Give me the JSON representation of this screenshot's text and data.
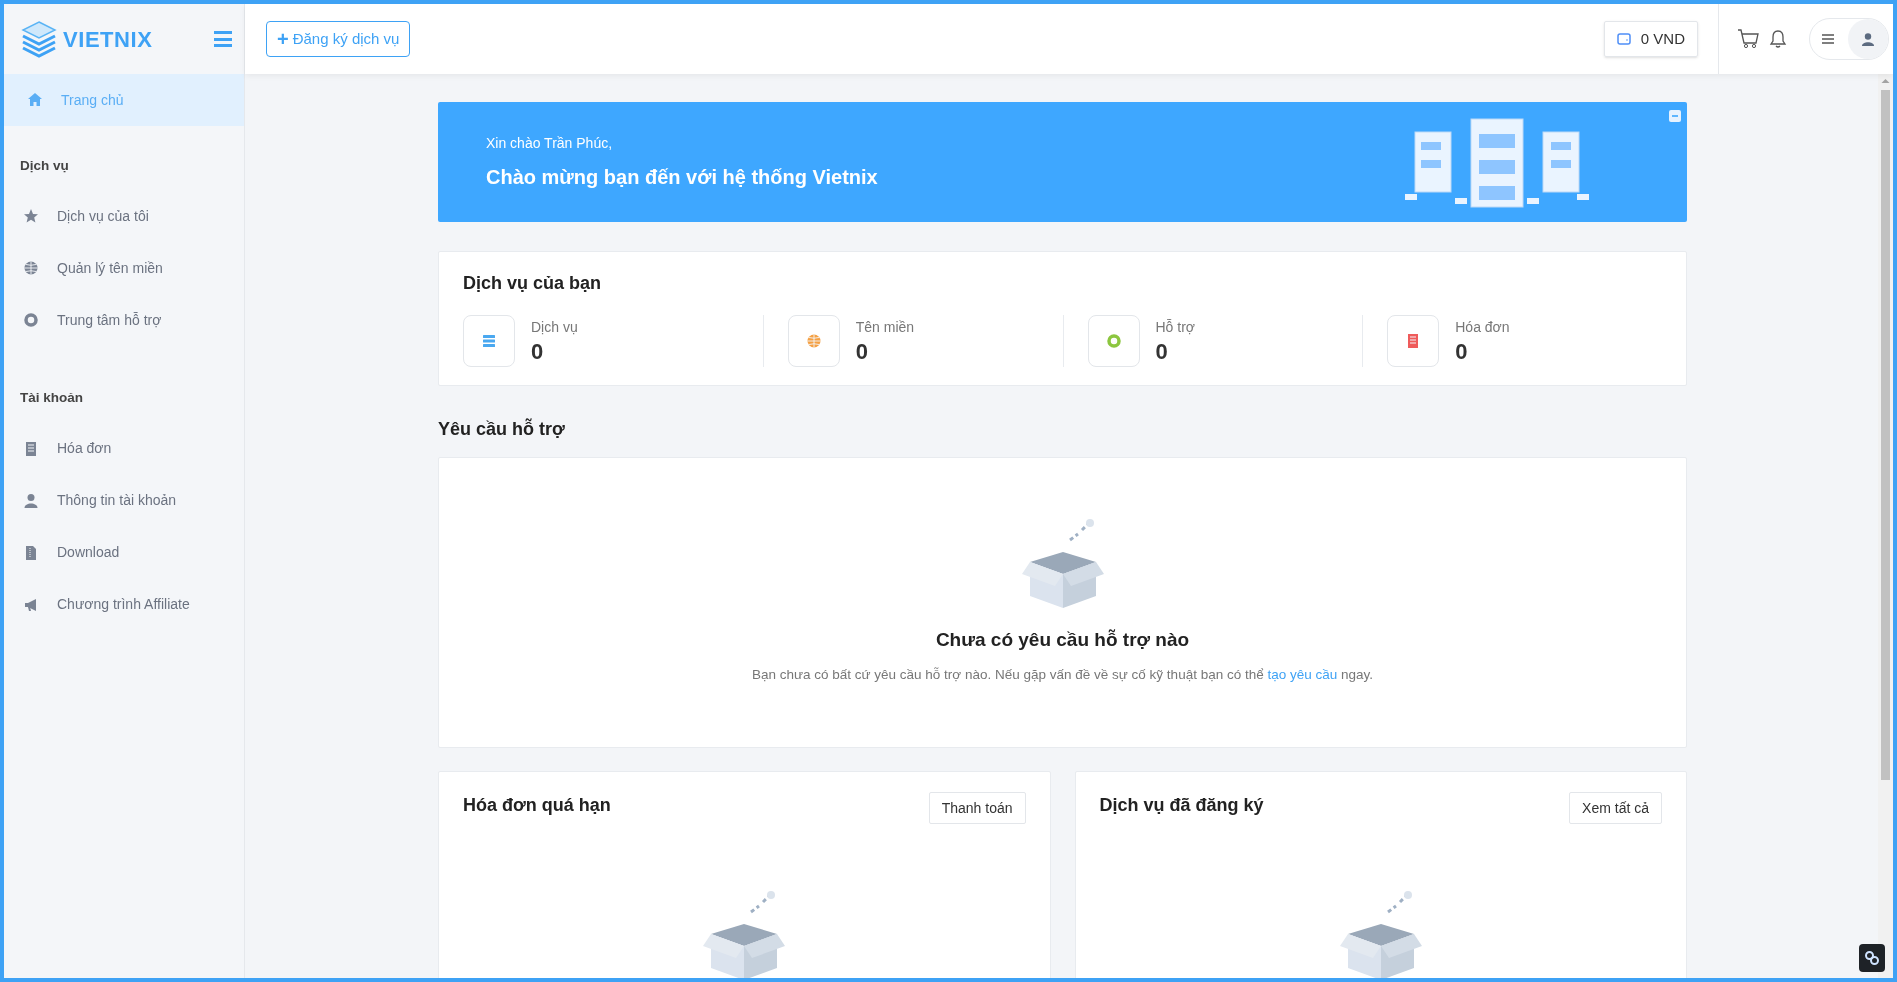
{
  "logo": {
    "text": "VIETNIX"
  },
  "header": {
    "register_button": "Đăng ký dịch vụ",
    "plus": "+",
    "balance": "0 VND"
  },
  "sidebar": {
    "home": {
      "label": "Trang chủ",
      "selected": true
    },
    "sections": [
      {
        "title": "Dịch vụ",
        "items": [
          {
            "label": "Dịch vụ của tôi",
            "selected": false
          },
          {
            "label": "Quản lý tên miền",
            "selected": false
          },
          {
            "label": "Trung tâm hỗ trợ",
            "selected": false
          }
        ]
      },
      {
        "title": "Tài khoản",
        "items": [
          {
            "label": "Hóa đơn",
            "selected": false
          },
          {
            "label": "Thông tin tài khoản",
            "selected": false
          },
          {
            "label": "Download",
            "selected": false
          },
          {
            "label": "Chương trình Affiliate",
            "selected": false
          }
        ]
      }
    ]
  },
  "banner": {
    "greeting": "Xin chào Trần Phúc,",
    "title": "Chào mừng bạn đến với hệ thống Vietnix"
  },
  "services_card": {
    "title": "Dịch vụ của bạn",
    "stats": [
      {
        "label": "Dịch vụ",
        "value": "0",
        "color": "#4aa8f0"
      },
      {
        "label": "Tên miền",
        "value": "0",
        "color": "#f5a043"
      },
      {
        "label": "Hỗ trợ",
        "value": "0",
        "color": "#8cc63f"
      },
      {
        "label": "Hóa đơn",
        "value": "0",
        "color": "#ef5b5b"
      }
    ]
  },
  "support": {
    "title": "Yêu cầu hỗ trợ",
    "empty_title": "Chưa có yêu cầu hỗ trợ nào",
    "empty_text": "Bạn chưa có bất cứ yêu cầu hỗ trợ nào. Nếu gặp vấn đề về sự cố kỹ thuật bạn có thể",
    "link": "tạo yêu cầu",
    "after_link": "ngay."
  },
  "bottom_cards": [
    {
      "title": "Hóa đơn quá hạn",
      "button": "Thanh toán"
    },
    {
      "title": "Dịch vụ đã đăng ký",
      "button": "Xem tất cả"
    }
  ]
}
